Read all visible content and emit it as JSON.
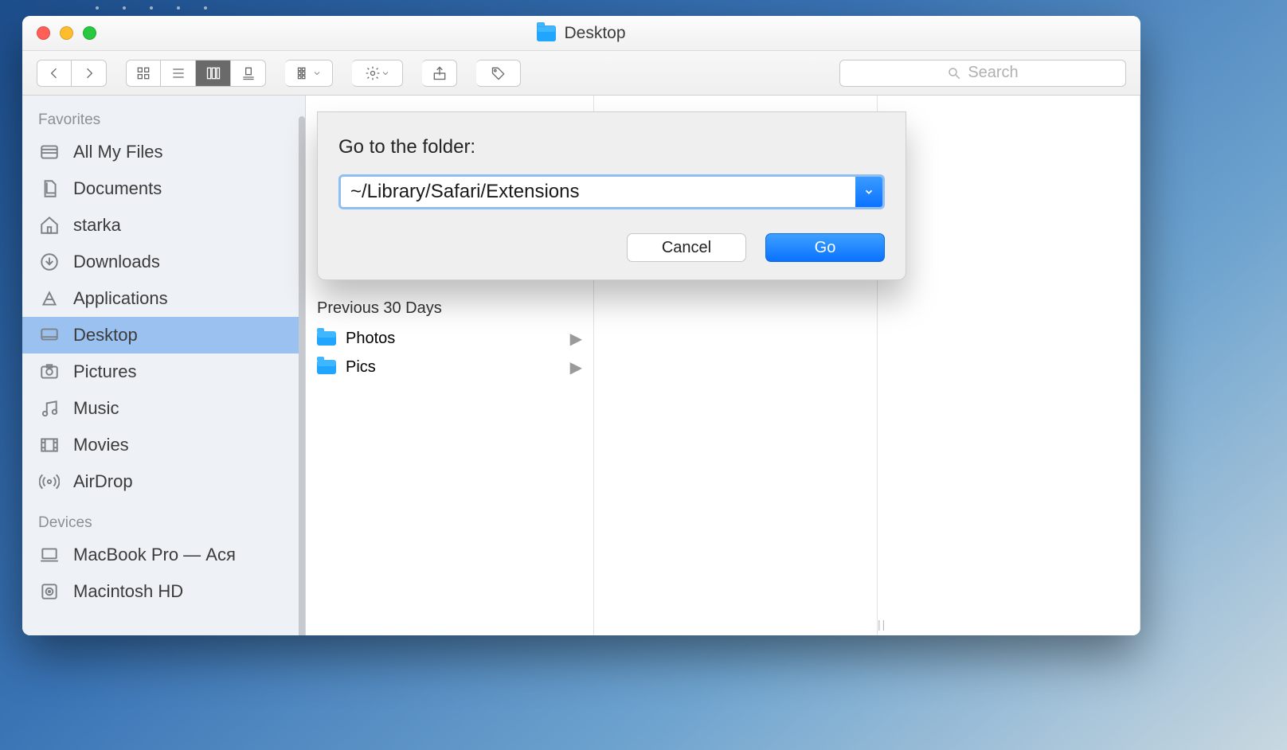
{
  "window": {
    "title": "Desktop"
  },
  "toolbar": {
    "search_placeholder": "Search"
  },
  "sidebar": {
    "sections": [
      {
        "title": "Favorites",
        "items": [
          {
            "label": "All My Files"
          },
          {
            "label": "Documents"
          },
          {
            "label": "starka"
          },
          {
            "label": "Downloads"
          },
          {
            "label": "Applications"
          },
          {
            "label": "Desktop"
          },
          {
            "label": "Pictures"
          },
          {
            "label": "Music"
          },
          {
            "label": "Movies"
          },
          {
            "label": "AirDrop"
          }
        ]
      },
      {
        "title": "Devices",
        "items": [
          {
            "label": "MacBook Pro — Ася"
          },
          {
            "label": "Macintosh HD"
          }
        ]
      }
    ]
  },
  "content": {
    "section_header": "Previous 30 Days",
    "rows": [
      {
        "name": "Photos"
      },
      {
        "name": "Pics"
      }
    ]
  },
  "dialog": {
    "label": "Go to the folder:",
    "path": "~/Library/Safari/Extensions",
    "cancel": "Cancel",
    "go": "Go"
  }
}
